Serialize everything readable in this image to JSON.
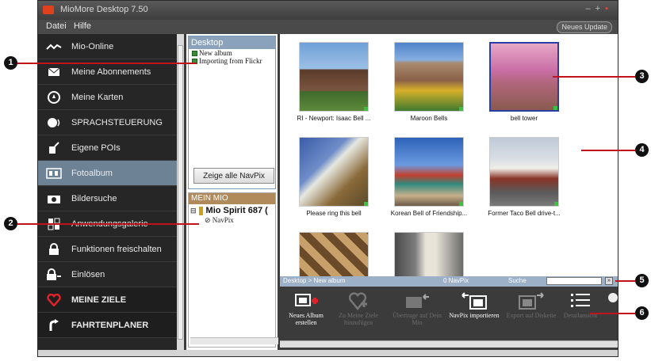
{
  "window": {
    "title": "MioMore Desktop 7.50"
  },
  "menu": {
    "items": [
      "Datei",
      "Hilfe"
    ],
    "update_button": "Neues Update"
  },
  "sidebar": {
    "items": [
      {
        "label": "Mio-Online",
        "icon": "wave-icon"
      },
      {
        "label": "Meine Abonnements",
        "icon": "envelope-icon"
      },
      {
        "label": "Meine Karten",
        "icon": "compass-icon"
      },
      {
        "label": "SPRACHSTEUERUNG",
        "icon": "voice-icon"
      },
      {
        "label": "Eigene POIs",
        "icon": "poi-icon"
      },
      {
        "label": "Fotoalbum",
        "icon": "photo-album-icon",
        "active": true
      },
      {
        "label": "Bildersuche",
        "icon": "camera-icon"
      },
      {
        "label": "Anwendungsgalerie",
        "icon": "grid-icon"
      },
      {
        "label": "Funktionen freischalten",
        "icon": "lock-icon"
      },
      {
        "label": "Einlösen",
        "icon": "lock-key-icon"
      },
      {
        "label": "MEINE ZIELE",
        "icon": "heart-icon"
      },
      {
        "label": "FAHRTENPLANER",
        "icon": "route-icon"
      }
    ]
  },
  "desktop_panel": {
    "title": "Desktop",
    "items": [
      "New album",
      "Importing from Flickr"
    ],
    "show_all_button": "Zeige alle NavPix"
  },
  "mio_panel": {
    "title": "MEIN MIO",
    "device": "Mio Spirit 687 (",
    "child": "NavPix"
  },
  "photos": [
    {
      "caption": "RI - Newport: Isaac Bell ...",
      "selected": false
    },
    {
      "caption": "Maroon Bells",
      "selected": false
    },
    {
      "caption": "bell tower",
      "selected": true
    },
    {
      "caption": "Please ring this bell",
      "selected": false
    },
    {
      "caption": "Korean Bell of Friendship...",
      "selected": false
    },
    {
      "caption": "Former Taco Bell drive-t...",
      "selected": false
    },
    {
      "caption": "",
      "selected": false
    },
    {
      "caption": "",
      "selected": false
    }
  ],
  "search_bar": {
    "breadcrumb": "Desktop > New album",
    "count": "0 NavPix",
    "search_label": "Suche"
  },
  "toolbar": {
    "tools": [
      {
        "label": "Neues Album erstellen",
        "enabled": true,
        "icon": "new-album-icon"
      },
      {
        "label": "Zu Meine Ziele hinzufügen",
        "enabled": false,
        "icon": "heart-add-icon"
      },
      {
        "label": "Übertrage auf Dein Mio",
        "enabled": false,
        "icon": "transfer-to-mio-icon"
      },
      {
        "label": "NavPix importieren",
        "enabled": true,
        "icon": "import-icon"
      },
      {
        "label": "Export auf Diskette",
        "enabled": false,
        "icon": "export-icon"
      },
      {
        "label": "Detailansicht",
        "enabled": false,
        "icon": "list-view-icon"
      }
    ]
  },
  "callouts": [
    "1",
    "2",
    "3",
    "4",
    "5",
    "6"
  ]
}
